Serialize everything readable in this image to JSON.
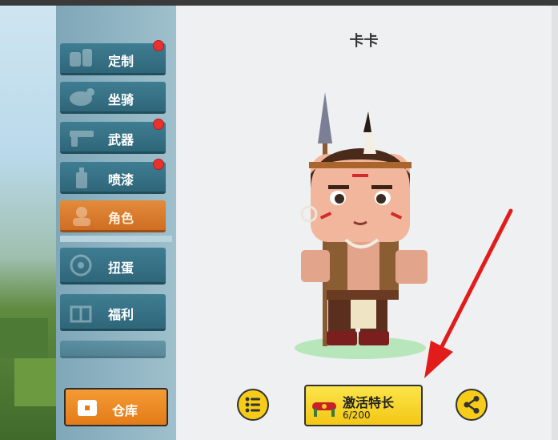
{
  "sidebar": {
    "items": [
      {
        "label": "定制",
        "icon": "customize-icon",
        "badge": true
      },
      {
        "label": "坐骑",
        "icon": "mount-icon",
        "badge": false
      },
      {
        "label": "武器",
        "icon": "weapon-icon",
        "badge": true
      },
      {
        "label": "喷漆",
        "icon": "spray-paint-icon",
        "badge": true
      },
      {
        "label": "角色",
        "icon": "character-icon",
        "badge": false,
        "active": true
      },
      {
        "label": "扭蛋",
        "icon": "gacha-icon",
        "badge": false
      },
      {
        "label": "福利",
        "icon": "gift-icon",
        "badge": false
      }
    ],
    "warehouse_label": "仓库"
  },
  "character": {
    "name": "卡卡"
  },
  "actions": {
    "activate_label": "激活特长",
    "activate_progress": "6/200"
  },
  "colors": {
    "accent_orange": "#e37c18",
    "button_yellow": "#f6cc19",
    "menu_blue": "#3f7d92",
    "badge_red": "#e8322e",
    "arrow_red": "#e21b1b"
  }
}
